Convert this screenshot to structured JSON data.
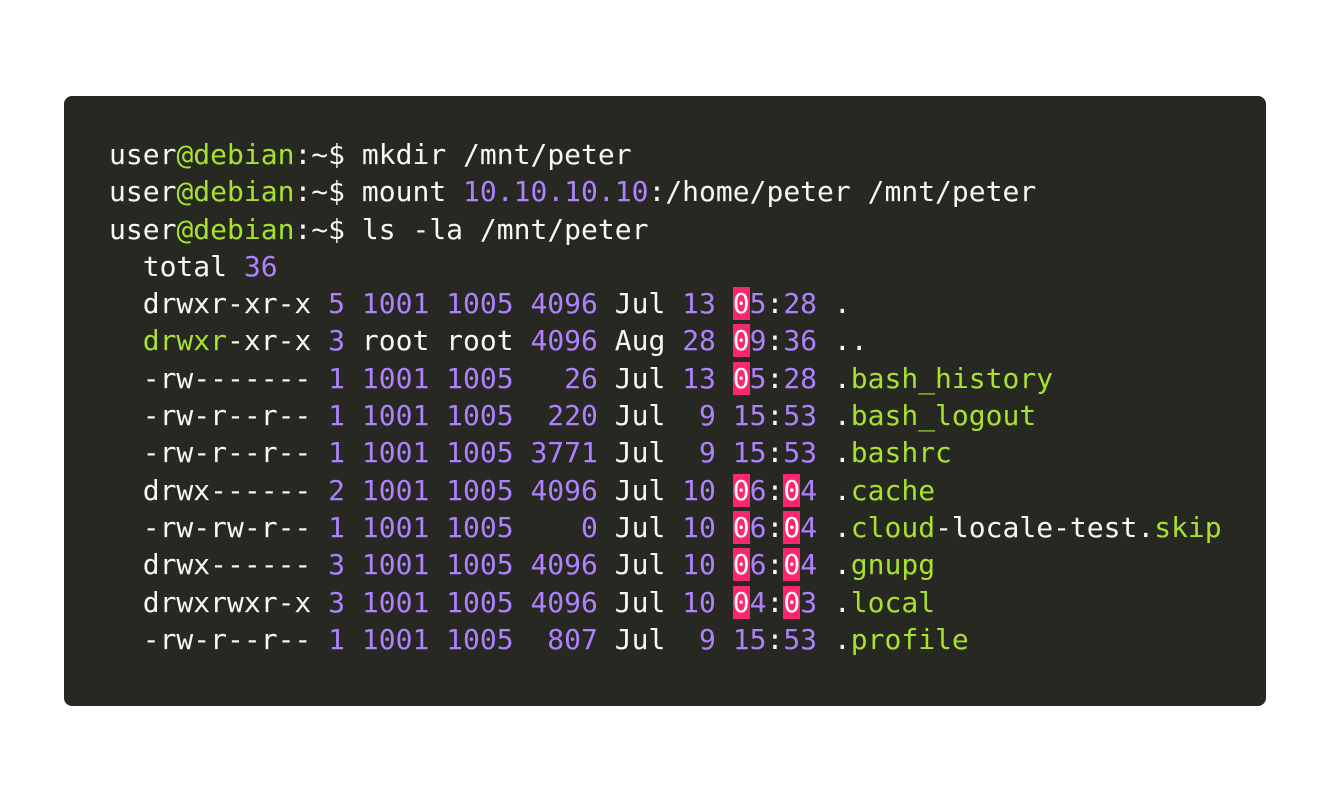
{
  "colors": {
    "background": "#272822",
    "text": "#f8f8f2",
    "green": "#a6e22e",
    "purple": "#ae81ff",
    "highlight": "#f92672"
  },
  "terminal": {
    "lines": [
      [
        [
          "user",
          "white"
        ],
        [
          "@debian",
          "green"
        ],
        [
          ":~$ mkdir /mnt/peter",
          "white"
        ]
      ],
      [
        [
          "user",
          "white"
        ],
        [
          "@debian",
          "green"
        ],
        [
          ":~$ mount ",
          "white"
        ],
        [
          "10.10.10.10",
          "purple"
        ],
        [
          ":/home/peter /mnt/peter",
          "white"
        ]
      ],
      [
        [
          "user",
          "white"
        ],
        [
          "@debian",
          "green"
        ],
        [
          ":~$ ls -la /mnt/peter",
          "white"
        ]
      ],
      [
        [
          "  total ",
          "white"
        ],
        [
          "36",
          "purple"
        ]
      ],
      [
        [
          "  drwxr-xr-x ",
          "white"
        ],
        [
          "5 1001 1005 4096",
          "purple"
        ],
        [
          " Jul ",
          "white"
        ],
        [
          "13 ",
          "purple"
        ],
        [
          "0",
          "hl"
        ],
        [
          "5",
          "purple"
        ],
        [
          ":",
          "white"
        ],
        [
          "28",
          "purple"
        ],
        [
          " .",
          "white"
        ]
      ],
      [
        [
          "  ",
          "white"
        ],
        [
          "drwxr",
          "green"
        ],
        [
          "-xr-x ",
          "white"
        ],
        [
          "3",
          "purple"
        ],
        [
          " root root ",
          "white"
        ],
        [
          "4096",
          "purple"
        ],
        [
          " Aug ",
          "white"
        ],
        [
          "28 ",
          "purple"
        ],
        [
          "0",
          "hl"
        ],
        [
          "9",
          "purple"
        ],
        [
          ":",
          "white"
        ],
        [
          "36",
          "purple"
        ],
        [
          " ..",
          "white"
        ]
      ],
      [
        [
          "  -rw------- ",
          "white"
        ],
        [
          "1 1001 1005   26",
          "purple"
        ],
        [
          " Jul ",
          "white"
        ],
        [
          "13 ",
          "purple"
        ],
        [
          "0",
          "hl"
        ],
        [
          "5",
          "purple"
        ],
        [
          ":",
          "white"
        ],
        [
          "28",
          "purple"
        ],
        [
          " .",
          "white"
        ],
        [
          "bash_history",
          "green"
        ]
      ],
      [
        [
          "  -rw-r--r-- ",
          "white"
        ],
        [
          "1 1001 1005  220",
          "purple"
        ],
        [
          " Jul  ",
          "white"
        ],
        [
          "9 15",
          "purple"
        ],
        [
          ":",
          "white"
        ],
        [
          "53",
          "purple"
        ],
        [
          " .",
          "white"
        ],
        [
          "bash_logout",
          "green"
        ]
      ],
      [
        [
          "  -rw-r--r-- ",
          "white"
        ],
        [
          "1 1001 1005 3771",
          "purple"
        ],
        [
          " Jul  ",
          "white"
        ],
        [
          "9 15",
          "purple"
        ],
        [
          ":",
          "white"
        ],
        [
          "53",
          "purple"
        ],
        [
          " .",
          "white"
        ],
        [
          "bashrc",
          "green"
        ]
      ],
      [
        [
          "  drwx------ ",
          "white"
        ],
        [
          "2 1001 1005 4096",
          "purple"
        ],
        [
          " Jul ",
          "white"
        ],
        [
          "10 ",
          "purple"
        ],
        [
          "0",
          "hl"
        ],
        [
          "6",
          "purple"
        ],
        [
          ":",
          "white"
        ],
        [
          "0",
          "hl"
        ],
        [
          "4",
          "purple"
        ],
        [
          " .",
          "white"
        ],
        [
          "cache",
          "green"
        ]
      ],
      [
        [
          "  -rw-rw-r-- ",
          "white"
        ],
        [
          "1 1001 1005    0",
          "purple"
        ],
        [
          " Jul ",
          "white"
        ],
        [
          "10 ",
          "purple"
        ],
        [
          "0",
          "hl"
        ],
        [
          "6",
          "purple"
        ],
        [
          ":",
          "white"
        ],
        [
          "0",
          "hl"
        ],
        [
          "4",
          "purple"
        ],
        [
          " .",
          "white"
        ],
        [
          "cloud",
          "green"
        ],
        [
          "-locale-test.",
          "white"
        ],
        [
          "skip",
          "green"
        ]
      ],
      [
        [
          "  drwx------ ",
          "white"
        ],
        [
          "3 1001 1005 4096",
          "purple"
        ],
        [
          " Jul ",
          "white"
        ],
        [
          "10 ",
          "purple"
        ],
        [
          "0",
          "hl"
        ],
        [
          "6",
          "purple"
        ],
        [
          ":",
          "white"
        ],
        [
          "0",
          "hl"
        ],
        [
          "4",
          "purple"
        ],
        [
          " .",
          "white"
        ],
        [
          "gnupg",
          "green"
        ]
      ],
      [
        [
          "  drwxrwxr-x ",
          "white"
        ],
        [
          "3 1001 1005 4096",
          "purple"
        ],
        [
          " Jul ",
          "white"
        ],
        [
          "10 ",
          "purple"
        ],
        [
          "0",
          "hl"
        ],
        [
          "4",
          "purple"
        ],
        [
          ":",
          "white"
        ],
        [
          "0",
          "hl"
        ],
        [
          "3",
          "purple"
        ],
        [
          " .",
          "white"
        ],
        [
          "local",
          "green"
        ]
      ],
      [
        [
          "  -rw-r--r-- ",
          "white"
        ],
        [
          "1 1001 1005  807",
          "purple"
        ],
        [
          " Jul  ",
          "white"
        ],
        [
          "9 15",
          "purple"
        ],
        [
          ":",
          "white"
        ],
        [
          "53",
          "purple"
        ],
        [
          " .",
          "white"
        ],
        [
          "profile",
          "green"
        ]
      ]
    ]
  }
}
